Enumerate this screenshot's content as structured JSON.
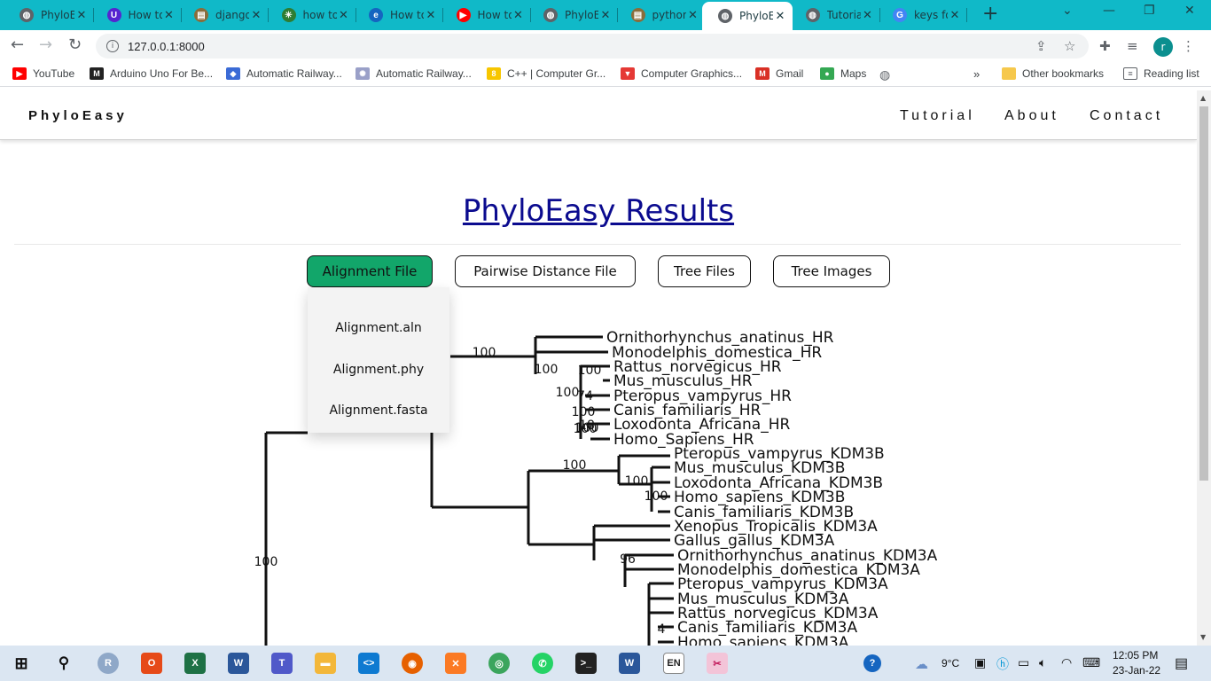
{
  "browser": {
    "tabs": [
      {
        "title": "PhyloE",
        "icon": "globe-icon",
        "color": "#5f6368"
      },
      {
        "title": "How to",
        "icon": "udemy-icon",
        "color": "#5624d0"
      },
      {
        "title": "django",
        "icon": "document-icon",
        "color": "#8a6d3b"
      },
      {
        "title": "how to",
        "icon": "star-icon",
        "color": "#2e7d32"
      },
      {
        "title": "How to",
        "icon": "e-icon",
        "color": "#1565c0"
      },
      {
        "title": "How to",
        "icon": "youtube-icon",
        "color": "#ff0000"
      },
      {
        "title": "PhyloE",
        "icon": "globe-icon",
        "color": "#5f6368"
      },
      {
        "title": "python",
        "icon": "document-icon",
        "color": "#8a6d3b"
      },
      {
        "title": "PhyloE",
        "icon": "globe-icon",
        "color": "#5f6368"
      },
      {
        "title": "Tutoria",
        "icon": "globe-icon",
        "color": "#5f6368"
      },
      {
        "title": "keys fo",
        "icon": "google-icon",
        "color": "#4285f4"
      }
    ],
    "active_tab_index": 8,
    "url": "127.0.0.1:8000",
    "profile_initial": "r",
    "bookmarks": [
      {
        "label": "YouTube",
        "icon": "youtube-icon",
        "color": "#ff0000"
      },
      {
        "label": "Arduino Uno For Be...",
        "icon": "maker-icon",
        "color": "#222222"
      },
      {
        "label": "Automatic Railway...",
        "icon": "diamond-icon",
        "color": "#3b6bd6"
      },
      {
        "label": "Automatic Railway...",
        "icon": "sparkle-icon",
        "color": "#9aa0c8"
      },
      {
        "label": "C++ | Computer Gr...",
        "icon": "eight-icon",
        "color": "#f7c600"
      },
      {
        "label": "Computer Graphics...",
        "icon": "triangle-icon",
        "color": "#e53935"
      },
      {
        "label": "Gmail",
        "icon": "gmail-icon",
        "color": "#d93025"
      },
      {
        "label": "Maps",
        "icon": "maps-icon",
        "color": "#34a853"
      }
    ],
    "other_bookmarks": "Other bookmarks",
    "reading_list": "Reading list"
  },
  "site": {
    "brand": "PhyloEasy",
    "nav": [
      "Tutorial",
      "About",
      "Contact"
    ],
    "title": "PhyloEasy Results",
    "buttons": [
      "Alignment File",
      "Pairwise Distance File",
      "Tree Files",
      "Tree Images"
    ],
    "active_button": "Alignment File",
    "dropdown": [
      "Alignment.aln",
      "Alignment.phy",
      "Alignment.fasta"
    ]
  },
  "tree": {
    "leaves": [
      "Ornithorhynchus_anatinus_HR",
      "Monodelphis_domestica_HR",
      "Rattus_norvegicus_HR",
      "Mus_musculus_HR",
      "Pteropus_vampyrus_HR",
      "Canis_familiaris_HR",
      "Loxodonta_Africana_HR",
      "Homo_Sapiens_HR",
      "Pteropus_vampyrus_KDM3B",
      "Mus_musculus_KDM3B",
      "Loxodonta_Africana_KDM3B",
      "Homo_sapiens_KDM3B",
      "Canis_familiaris_KDM3B",
      "Xenopus_Tropicalis_KDM3A",
      "Gallus_gallus_KDM3A",
      "Ornithorhynchus_anatinus_KDM3A",
      "Monodelphis_domestica_KDM3A",
      "Pteropus_vampyrus_KDM3A",
      "Mus_musculus_KDM3A",
      "Rattus_norvegicus_KDM3A",
      "Canis_familiaris_KDM3A",
      "Homo_sapiens_KDM3A"
    ],
    "support_labels": [
      "100",
      "100",
      "100",
      "100",
      "100",
      "100",
      "100",
      "100",
      "100",
      "100",
      "100",
      "96",
      "4",
      "74",
      "18"
    ]
  },
  "taskbar": {
    "weather": "9°C",
    "time": "12:05 PM",
    "date": "23-Jan-22",
    "lang": "EN"
  }
}
